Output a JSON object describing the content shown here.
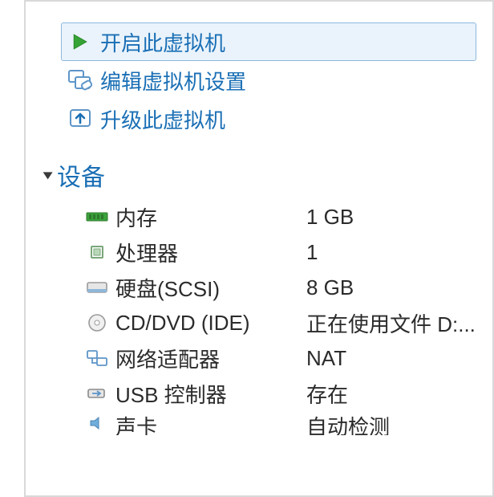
{
  "actions": {
    "power_on": "开启此虚拟机",
    "edit_settings": "编辑虚拟机设置",
    "upgrade_vm": "升级此虚拟机"
  },
  "section": {
    "devices_title": "设备"
  },
  "devices": {
    "memory": {
      "label": "内存",
      "value": "1 GB"
    },
    "cpu": {
      "label": "处理器",
      "value": "1"
    },
    "disk": {
      "label": "硬盘(SCSI)",
      "value": "8 GB"
    },
    "cd": {
      "label": "CD/DVD (IDE)",
      "value": "正在使用文件 D:..."
    },
    "net": {
      "label": "网络适配器",
      "value": "NAT"
    },
    "usb": {
      "label": "USB 控制器",
      "value": "存在"
    },
    "sound": {
      "label": "声卡",
      "value": "自动检测"
    }
  },
  "icons": {
    "play": "play-icon",
    "edit": "settings-icon",
    "upgrade": "upgrade-icon",
    "memory": "memory-icon",
    "cpu": "cpu-icon",
    "disk": "disk-icon",
    "cd": "cd-icon",
    "net": "network-icon",
    "usb": "usb-icon",
    "sound": "sound-icon"
  }
}
